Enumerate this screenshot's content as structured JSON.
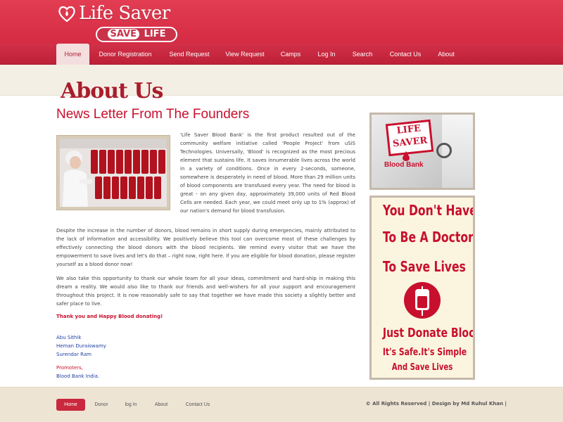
{
  "header": {
    "logo_title": "Life Saver",
    "logo_badge_save": "SAVE",
    "logo_badge_life": "LIFE"
  },
  "nav": {
    "items": [
      "Home",
      "Donor Registration",
      "Send Request",
      "View Request",
      "Camps",
      "Log In",
      "Search",
      "Contact Us",
      "About"
    ],
    "active": "Home"
  },
  "page": {
    "heading": "About Us",
    "news_title": "News Letter From The Founders",
    "paragraphs": [
      "'Life Saver Blood Bank' is the first product resulted out of the community welfare initiative called 'People Project' from uSiS Technologies. Universally, 'Blood' is recognized as the most precious element that sustains life. It saves innumerable lives across the world in a variety of conditions. Once in every 2-seconds, someone, somewhere is desperately in need of blood. More than 29 million units of blood components are transfused every year. The need for blood is great - on any given day, approximately 39,000 units of Red Blood Cells are needed. Each year, we could meet only up to 1% (approx) of our nation's demand for blood transfusion.",
      "Despite the increase in the number of donors, blood remains in short supply during emergencies, mainly attributed to the lack of information and accessibility. We positively believe this tool can overcome most of these challenges by effectively connecting the blood donors with the blood recipients. We remind every visitor that we have the empowerment to save lives and let's do that – right now, right here. If you are eligible for blood donation, please register yourself as a blood donor now!",
      "We also take this opportunity to thank our whole team for all your ideas, commitment and hard-ship in making this dream a reality. We would also like to thank our friends and well-wishers for all your support and encouragement throughout this project. It is now reasonably safe to say that together we have made this society a slightly better and safer place to live."
    ],
    "thanks": "Thank you and Happy Blood donating!",
    "founders": [
      "Abu Sithik",
      "Heman Duraiswamy",
      "Surendar Ram"
    ],
    "promoters_label": "Promoters,",
    "promoters_value": "Blood Bank India."
  },
  "sidebar": {
    "card1": {
      "line1": "LIFE",
      "line2": "SAVER",
      "caption": "Blood Bank"
    },
    "card2": {
      "line1": "You Don't Have",
      "line2": "To Be A Doctor",
      "line3": "To Save Lives",
      "line4": "Just Donate Blood",
      "line5": "It's Safe.It's Simple",
      "line6": "And Save Lives"
    }
  },
  "footer": {
    "links": [
      "Home",
      "Donor",
      "log In",
      "About",
      "Contact Us"
    ],
    "active": "Home",
    "copyright": "© All Rights Reserved | Design by Md Ruhul Khan |"
  },
  "colors": {
    "brand_red": "#d52b44",
    "accent_red": "#c8102e",
    "link_blue": "#1f3fa6",
    "strip_bg": "#f4efe4",
    "footer_bg": "#eee4d4"
  }
}
